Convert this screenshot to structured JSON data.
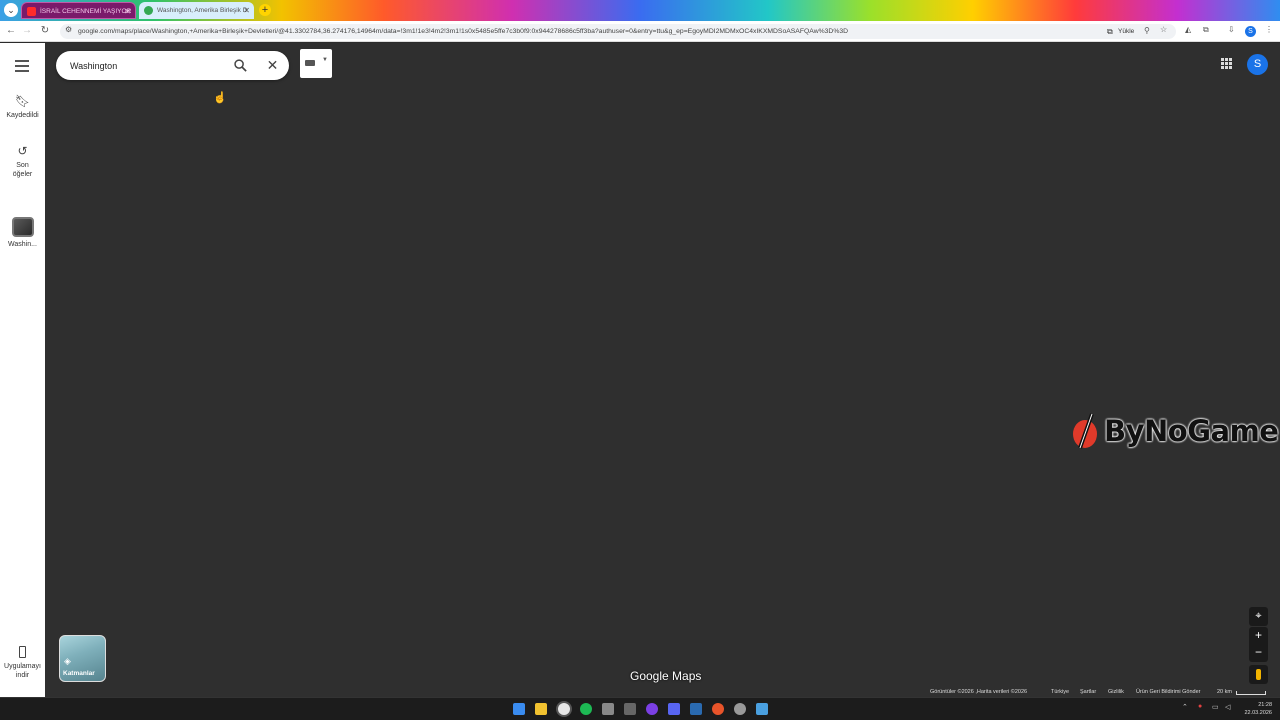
{
  "browser": {
    "tabs": [
      {
        "label": "İSRAİL CEHENNEMİ YAŞIYOR",
        "active": false
      },
      {
        "label": "Washington, Amerika Birleşik D",
        "active": true
      }
    ],
    "url": "google.com/maps/place/Washington,+Amerika+Birleşik+Devletleri/@41.3302784,36.274176,14964m/data=!3m1!1e3!4m2!3m1!1s0x5485e5ffe7c3b0f9:0x944278686c5ff3ba?authuser=0&entry=ttu&g_ep=EgoyMDI2MDMxOC4xIKXMDSoASAFQAw%3D%3D",
    "install_label": "Yükle",
    "profile_initial": "S"
  },
  "rail": {
    "saved_label": "Kaydedildi",
    "recent_label": "Son öğeler",
    "place_label": "Washin...",
    "install_app_label": "Uygulamayı indir"
  },
  "search": {
    "value": "Washington"
  },
  "account": {
    "initial": "S"
  },
  "watermark": {
    "text": "ByNoGame"
  },
  "layers": {
    "label": "Katmanlar"
  },
  "brand": {
    "text": "Google Maps"
  },
  "footer": {
    "imagery": "Görüntüler ©2026 ,Harita verileri ©2026",
    "region": "Türkiye",
    "terms": "Şartlar",
    "privacy": "Gizlilik",
    "feedback": "Ürün Geri Bildirimi Gönder",
    "scale": "20 km"
  },
  "taskbar": {
    "time": "21:28",
    "date": "22.03.2026"
  }
}
